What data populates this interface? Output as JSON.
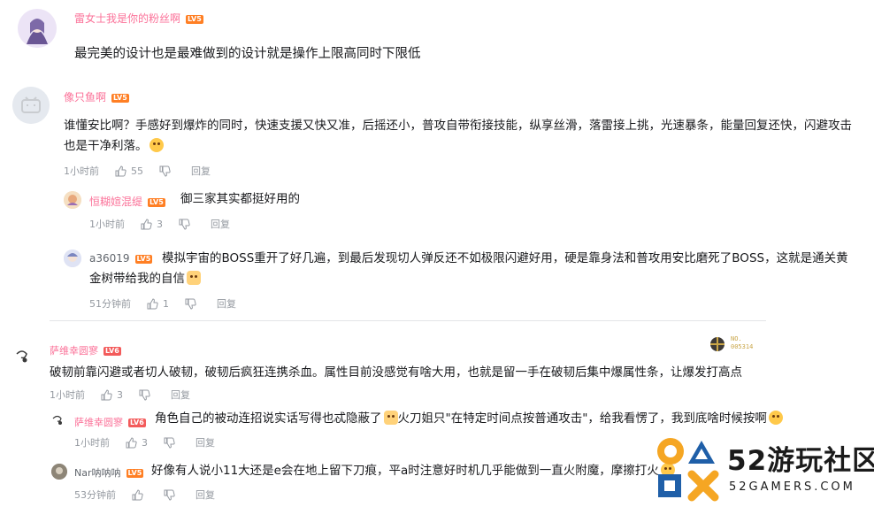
{
  "comments": [
    {
      "user": "雷女士我是你的粉丝啊",
      "level": "LV5",
      "text": "最完美的设计也是最难做到的设计就是操作上限高同时下限低"
    },
    {
      "user": "像只鱼啊",
      "level": "LV5",
      "text": "谁懂安比啊？手感好到爆炸的同时，快速支援又快又准，后摇还小，普攻自带衔接技能，纵享丝滑，落雷接上挑，光速暴条，能量回复还快，闪避攻击也是干净利落。",
      "time": "1小时前",
      "likes": "55",
      "reply": "回复"
    },
    {
      "user": "恒糊媗混缇",
      "level": "LV5",
      "text": "御三家其实都挺好用的",
      "time": "1小时前",
      "likes": "3",
      "reply": "回复"
    },
    {
      "user": "a36019",
      "level": "LV5",
      "text": "模拟宇宙的BOSS重开了好几遍，到最后发现切人弹反还不如极限闪避好用，硬是靠身法和普攻用安比磨死了BOSS，这就是通关黄金树带给我的自信",
      "time": "51分钟前",
      "likes": "1",
      "reply": "回复"
    },
    {
      "user": "萨维幸圆寥",
      "level": "LV6",
      "badge": "NO. 005314",
      "text": "破韧前靠闪避或者切人破韧，破韧后疯狂连携杀血。属性目前没感觉有啥大用，也就是留一手在破韧后集中爆属性条，让爆发打高点",
      "time": "1小时前",
      "likes": "3",
      "reply": "回复"
    },
    {
      "user": "萨维幸圆寥",
      "level": "LV6",
      "text_a": "角色自己的被动连招说实话写得也忒隐蔽了",
      "text_b": "火刀姐只\"在特定时间点按普通攻击\"，给我看愣了，我到底啥时候按啊",
      "time": "1小时前",
      "likes": "3",
      "reply": "回复"
    },
    {
      "user": "Nar呐呐呐",
      "level": "LV5",
      "text": "好像有人说小11大还是e会在地上留下刀痕，平a时注意好时机几乎能做到一直火附魔，摩擦打火",
      "time": "53分钟前",
      "likes": "",
      "reply": "回复"
    }
  ],
  "watermark": {
    "brand": "52游玩社区",
    "url": "52GAMERS.COM"
  }
}
